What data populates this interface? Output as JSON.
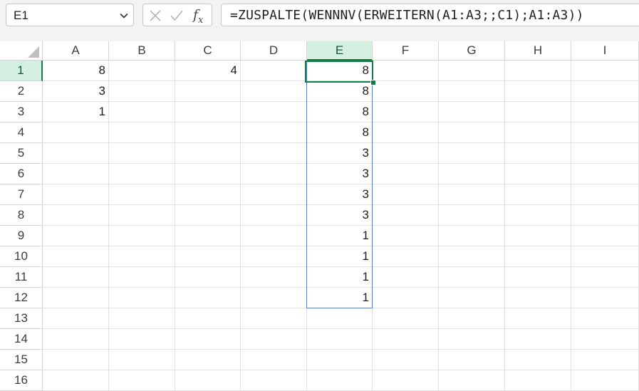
{
  "formula_bar": {
    "name_box": "E1",
    "formula": "=ZUSPALTE(WENNNV(ERWEITERN(A1:A3;;C1);A1:A3))",
    "icons": [
      "chevron-down-icon",
      "cancel-x-icon",
      "enter-check-icon",
      "fx-icon"
    ],
    "fx_label": "f",
    "fx_sub": "x"
  },
  "columns": [
    "A",
    "B",
    "C",
    "D",
    "E",
    "F",
    "G",
    "H",
    "I"
  ],
  "rows": [
    "1",
    "2",
    "3",
    "4",
    "5",
    "6",
    "7",
    "8",
    "9",
    "10",
    "11",
    "12",
    "13",
    "14",
    "15",
    "16"
  ],
  "selected_column": "E",
  "selected_row": "1",
  "cells": {
    "A1": "8",
    "A2": "3",
    "A3": "1",
    "C1": "4",
    "E1": "8",
    "E2": "8",
    "E3": "8",
    "E4": "8",
    "E5": "3",
    "E6": "3",
    "E7": "3",
    "E8": "3",
    "E9": "1",
    "E10": "1",
    "E11": "1",
    "E12": "1"
  },
  "colors": {
    "selection_green": "#137e43",
    "header_highlight": "#d3f0e0",
    "spill_border": "#5b7fb8",
    "gridline": "#e1e1e1"
  }
}
